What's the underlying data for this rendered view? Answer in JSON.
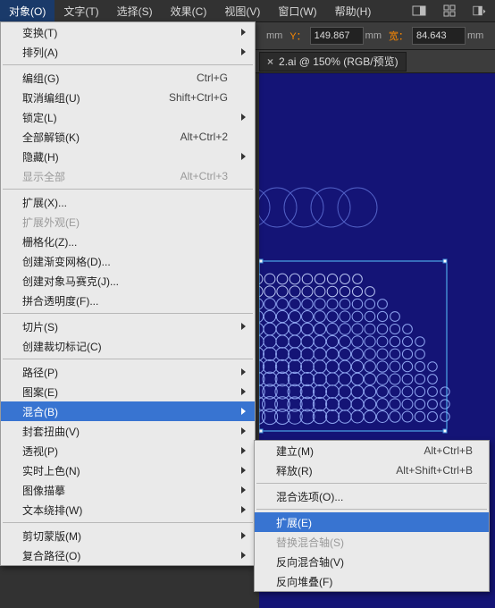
{
  "menubar": {
    "items": [
      "对象(O)",
      "文字(T)",
      "选择(S)",
      "效果(C)",
      "视图(V)",
      "窗口(W)",
      "帮助(H)"
    ],
    "active_index": 0
  },
  "toolbar": {
    "unit1": "mm",
    "y_label": "Y：",
    "y_value": "149.867",
    "unit2": "mm",
    "w_label": "宽：",
    "w_value": "84.643",
    "unit3": "mm"
  },
  "tab": {
    "label": "2.ai @ 150% (RGB/预览)"
  },
  "object_menu": {
    "items": [
      {
        "label": "变换(T)",
        "sub": true
      },
      {
        "label": "排列(A)",
        "sub": true
      },
      {
        "sep": true
      },
      {
        "label": "编组(G)",
        "shortcut": "Ctrl+G"
      },
      {
        "label": "取消编组(U)",
        "shortcut": "Shift+Ctrl+G"
      },
      {
        "label": "锁定(L)",
        "sub": true
      },
      {
        "label": "全部解锁(K)",
        "shortcut": "Alt+Ctrl+2"
      },
      {
        "label": "隐藏(H)",
        "sub": true
      },
      {
        "label": "显示全部",
        "shortcut": "Alt+Ctrl+3",
        "disabled": true
      },
      {
        "sep": true
      },
      {
        "label": "扩展(X)..."
      },
      {
        "label": "扩展外观(E)",
        "disabled": true
      },
      {
        "label": "栅格化(Z)..."
      },
      {
        "label": "创建渐变网格(D)..."
      },
      {
        "label": "创建对象马赛克(J)..."
      },
      {
        "label": "拼合透明度(F)..."
      },
      {
        "sep": true
      },
      {
        "label": "切片(S)",
        "sub": true
      },
      {
        "label": "创建裁切标记(C)"
      },
      {
        "sep": true
      },
      {
        "label": "路径(P)",
        "sub": true
      },
      {
        "label": "图案(E)",
        "sub": true
      },
      {
        "label": "混合(B)",
        "sub": true,
        "hover": true
      },
      {
        "label": "封套扭曲(V)",
        "sub": true
      },
      {
        "label": "透视(P)",
        "sub": true
      },
      {
        "label": "实时上色(N)",
        "sub": true
      },
      {
        "label": "图像描摹",
        "sub": true
      },
      {
        "label": "文本绕排(W)",
        "sub": true
      },
      {
        "sep": true
      },
      {
        "label": "剪切蒙版(M)",
        "sub": true
      },
      {
        "label": "复合路径(O)",
        "sub": true
      }
    ]
  },
  "blend_submenu": {
    "items": [
      {
        "label": "建立(M)",
        "shortcut": "Alt+Ctrl+B"
      },
      {
        "label": "释放(R)",
        "shortcut": "Alt+Shift+Ctrl+B"
      },
      {
        "sep": true
      },
      {
        "label": "混合选项(O)..."
      },
      {
        "sep": true
      },
      {
        "label": "扩展(E)",
        "hover": true
      },
      {
        "label": "替换混合轴(S)",
        "disabled": true
      },
      {
        "label": "反向混合轴(V)"
      },
      {
        "label": "反向堆叠(F)"
      }
    ]
  }
}
